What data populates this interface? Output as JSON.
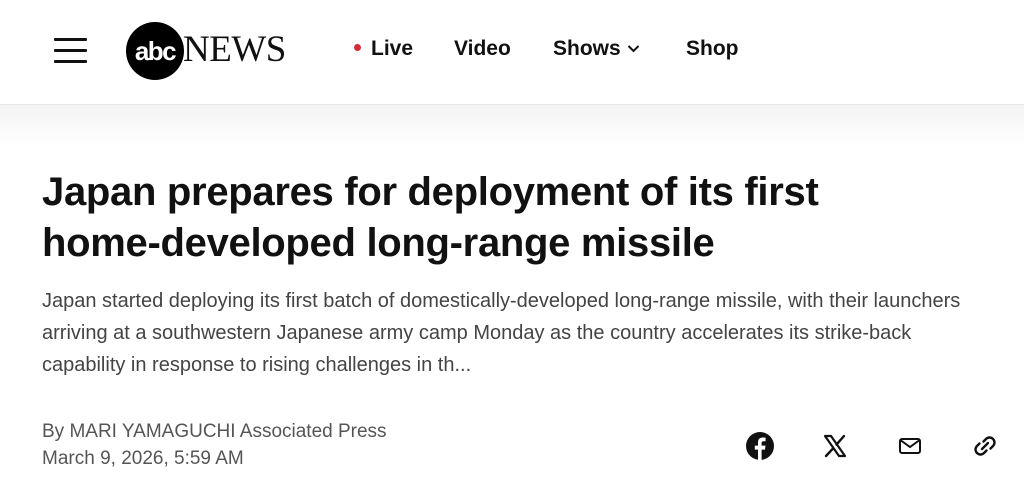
{
  "header": {
    "logo": {
      "circle_text": "abc",
      "wordmark": "NEWS"
    },
    "nav": [
      {
        "label": "Live",
        "indicator_color": "#d62c3a"
      },
      {
        "label": "Video"
      },
      {
        "label": "Shows",
        "icon": "chevron-down-icon"
      },
      {
        "label": "Shop"
      }
    ]
  },
  "article": {
    "headline_line1": "Japan prepares for deployment of its first",
    "headline_line2": "home-developed long-range missile",
    "summary": "Japan started deploying its first batch of domestically-developed long-range missile, with their launchers arriving at a southwestern Japanese army camp Monday as the country accelerates its strike-back capability in response to rising challenges in th...",
    "byline": "By MARI YAMAGUCHI Associated Press",
    "date": "March 9, 2026, 5:59 AM"
  },
  "share_icons": [
    "facebook-icon",
    "x-icon",
    "email-icon",
    "link-icon"
  ],
  "colors": {
    "text": "#111111",
    "summary_text": "#444444",
    "meta_text": "#555555",
    "live_dot": "#d62c3a"
  }
}
